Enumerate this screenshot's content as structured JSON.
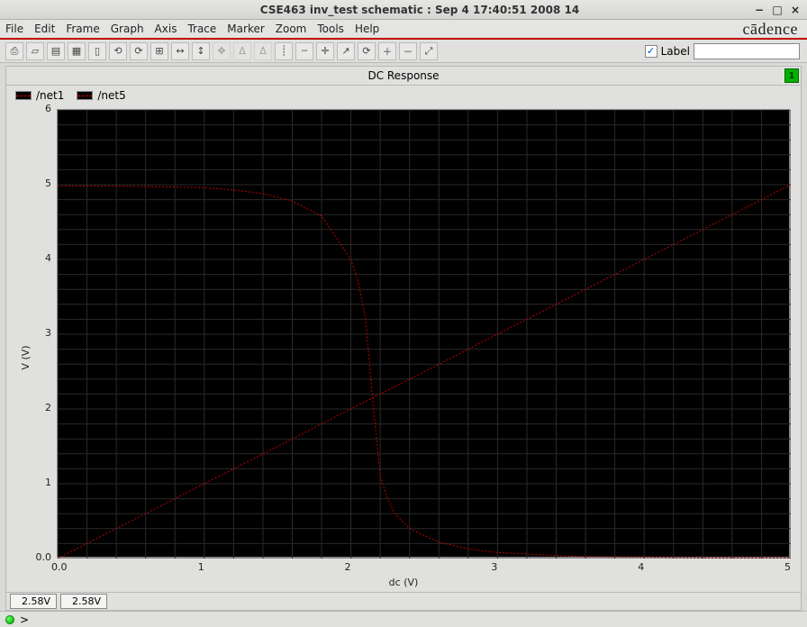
{
  "window": {
    "title": "CSE463 inv_test schematic : Sep  4 17:40:51 2008 14",
    "min_icon": "−",
    "max_icon": "□",
    "close_icon": "×"
  },
  "menu": {
    "items": [
      "File",
      "Edit",
      "Frame",
      "Graph",
      "Axis",
      "Trace",
      "Marker",
      "Zoom",
      "Tools",
      "Help"
    ],
    "brand": "cādence"
  },
  "toolbar": {
    "label_text": "Label",
    "label_checked": "✓",
    "label_value": "",
    "icons": [
      "print",
      "zoom-area",
      "axis-linear",
      "axis-grid",
      "snap",
      "undo",
      "redo",
      "fit",
      "fit-x",
      "fit-y",
      "pan",
      "delta",
      "delta2",
      "vert-marker",
      "horiz-marker",
      "crosshair",
      "arrow",
      "reload",
      "plus",
      "minus",
      "expand"
    ]
  },
  "chart": {
    "title": "DC Response",
    "badge": "1",
    "legend": [
      "/net1",
      "/net5"
    ],
    "ylabel": "V (V)",
    "xlabel": "dc (V)",
    "readouts": [
      "2.58V",
      "2.58V"
    ]
  },
  "status": {
    "prompt": ">"
  },
  "chart_data": {
    "type": "line",
    "title": "DC Response",
    "xlabel": "dc (V)",
    "ylabel": "V (V)",
    "xlim": [
      0,
      5
    ],
    "ylim": [
      0,
      6
    ],
    "xticks": [
      0.0,
      1,
      2,
      3,
      4,
      5
    ],
    "yticks": [
      0.0,
      1,
      2,
      3,
      4,
      5,
      6
    ],
    "grid": true,
    "grid_minor": 5,
    "legend_position": "top-left",
    "series": [
      {
        "name": "/net1",
        "color": "#c00000",
        "dash": true,
        "x": [
          0.0,
          0.4,
          0.8,
          1.0,
          1.2,
          1.4,
          1.6,
          1.8,
          2.0,
          2.05,
          2.1,
          2.15,
          2.2,
          2.25,
          2.3,
          2.4,
          2.6,
          2.8,
          3.0,
          3.5,
          4.0,
          4.5,
          5.0
        ],
        "values": [
          4.98,
          4.98,
          4.97,
          4.96,
          4.93,
          4.88,
          4.78,
          4.58,
          4.0,
          3.7,
          3.2,
          2.1,
          1.1,
          0.8,
          0.6,
          0.4,
          0.22,
          0.13,
          0.08,
          0.03,
          0.02,
          0.01,
          0.01
        ]
      },
      {
        "name": "/net5",
        "color": "#c00000",
        "dash": true,
        "x": [
          0.0,
          1.0,
          2.0,
          3.0,
          4.0,
          5.0
        ],
        "values": [
          0.0,
          1.0,
          2.0,
          3.0,
          4.0,
          5.0
        ]
      }
    ]
  }
}
